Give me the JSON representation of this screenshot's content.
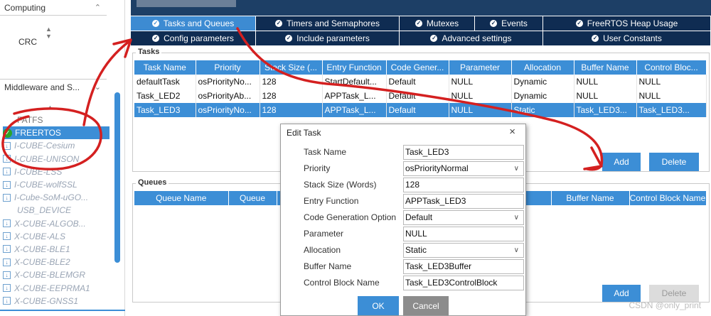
{
  "sidebar": {
    "computing_label": "Computing",
    "crc_label": "CRC",
    "middleware_label": "Middleware and S...",
    "fatfs_label": "FATFS",
    "items": [
      {
        "label": "FREERTOS",
        "state": "selected"
      },
      {
        "label": "I-CUBE-Cesium",
        "state": "box"
      },
      {
        "label": "I-CUBE-UNISON",
        "state": "box"
      },
      {
        "label": "I-CUBE-LSS",
        "state": "box"
      },
      {
        "label": "I-CUBE-wolfSSL",
        "state": "box"
      },
      {
        "label": "I-Cube-SoM-uGO...",
        "state": "box"
      },
      {
        "label": "USB_DEVICE",
        "state": "plain"
      },
      {
        "label": "X-CUBE-ALGOB...",
        "state": "box"
      },
      {
        "label": "X-CUBE-ALS",
        "state": "box"
      },
      {
        "label": "X-CUBE-BLE1",
        "state": "box"
      },
      {
        "label": "X-CUBE-BLE2",
        "state": "box"
      },
      {
        "label": "X-CUBE-BLEMGR",
        "state": "box"
      },
      {
        "label": "X-CUBE-EEPRMA1",
        "state": "box"
      },
      {
        "label": "X-CUBE-GNSS1",
        "state": "box"
      }
    ]
  },
  "tabs": {
    "row1": [
      "Tasks and Queues",
      "Timers and Semaphores",
      "Mutexes",
      "Events",
      "FreeRTOS Heap Usage"
    ],
    "row2": [
      "Config parameters",
      "Include parameters",
      "Advanced settings",
      "User Constants"
    ]
  },
  "tasks": {
    "label": "Tasks",
    "headers": [
      "Task Name",
      "Priority",
      "Stack Size (...",
      "Entry Function",
      "Code Gener...",
      "Parameter",
      "Allocation",
      "Buffer Name",
      "Control Bloc..."
    ],
    "rows": [
      [
        "defaultTask",
        "osPriorityNo...",
        "128",
        "StartDefault...",
        "Default",
        "NULL",
        "Dynamic",
        "NULL",
        "NULL"
      ],
      [
        "Task_LED2",
        "osPriorityAb...",
        "128",
        "APPTask_L...",
        "Default",
        "NULL",
        "Dynamic",
        "NULL",
        "NULL"
      ],
      [
        "Task_LED3",
        "osPriorityNo...",
        "128",
        "APPTask_L...",
        "Default",
        "NULL",
        "Static",
        "Task_LED3...",
        "Task_LED3..."
      ]
    ],
    "add_label": "Add",
    "delete_label": "Delete"
  },
  "queues": {
    "label": "Queues",
    "headers_left": [
      "Queue Name",
      "Queue"
    ],
    "headers_right": [
      "Buffer Name",
      "Control Block Name"
    ],
    "add_label": "Add",
    "delete_label": "Delete"
  },
  "dialog": {
    "title": "Edit Task",
    "close": "×",
    "fields": [
      {
        "label": "Task Name",
        "value": "Task_LED3",
        "dropdown": false
      },
      {
        "label": "Priority",
        "value": "osPriorityNormal",
        "dropdown": true
      },
      {
        "label": "Stack Size (Words)",
        "value": "128",
        "dropdown": false
      },
      {
        "label": "Entry Function",
        "value": "APPTask_LED3",
        "dropdown": false
      },
      {
        "label": "Code Generation Option",
        "value": "Default",
        "dropdown": true
      },
      {
        "label": "Parameter",
        "value": "NULL",
        "dropdown": false
      },
      {
        "label": "Allocation",
        "value": "Static",
        "dropdown": true
      },
      {
        "label": "Buffer Name",
        "value": "Task_LED3Buffer",
        "dropdown": false
      },
      {
        "label": "Control Block Name",
        "value": "Task_LED3ControlBlock",
        "dropdown": false
      }
    ],
    "ok_label": "OK",
    "cancel_label": "Cancel"
  },
  "watermark": "CSDN @only_print",
  "colors": {
    "accent": "#3c8ed6",
    "tab_dark": "#0f2c52",
    "annotation": "#d42020",
    "check": "#2aa52a"
  }
}
